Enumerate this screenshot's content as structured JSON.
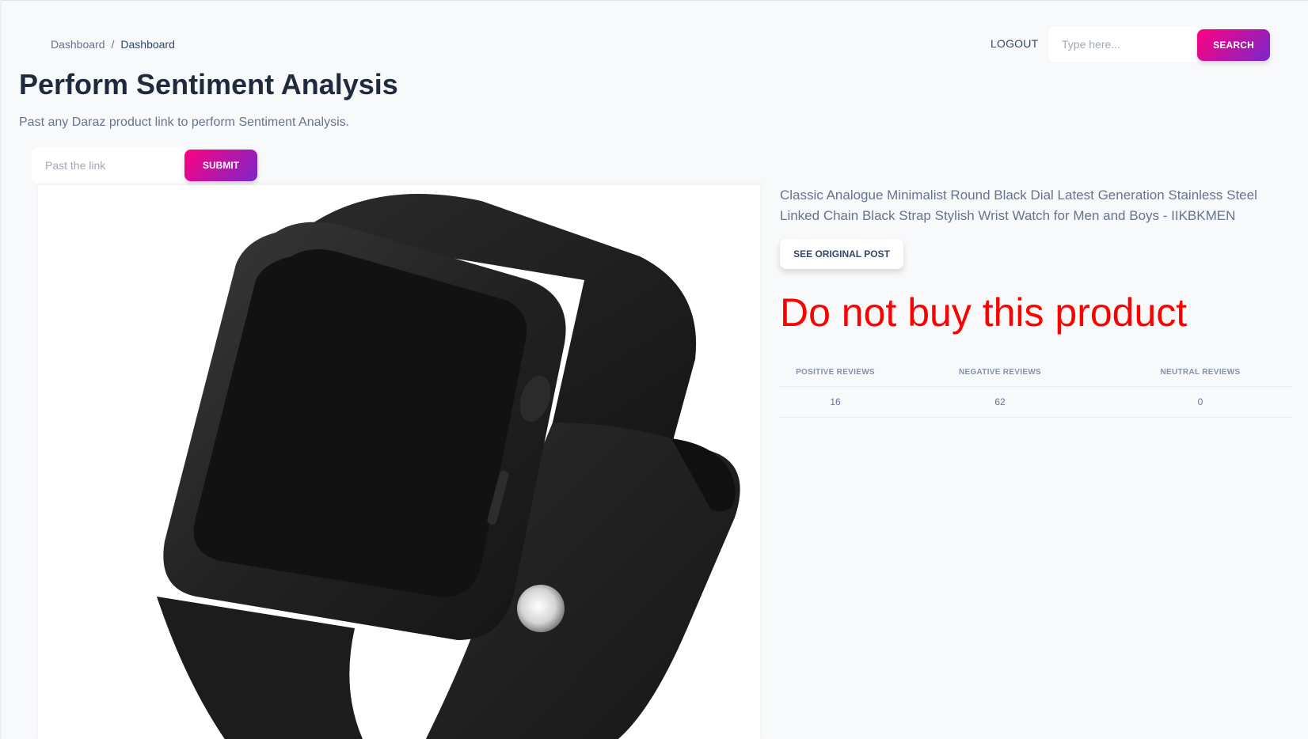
{
  "breadcrumb": {
    "parent": "Dashboard",
    "separator": "/",
    "current": "Dashboard"
  },
  "navbar": {
    "logout_label": "LOGOUT",
    "search_placeholder": "Type here...",
    "search_button": "SEARCH"
  },
  "page": {
    "title": "Perform Sentiment Analysis",
    "subtitle": "Past any Daraz product link to perform Sentiment Analysis."
  },
  "form": {
    "link_placeholder": "Past the link",
    "submit_label": "SUBMIT"
  },
  "product": {
    "image_icon": "smartwatch-image",
    "title": "Classic Analogue Minimalist Round Black Dial Latest Generation Stainless Steel Linked Chain Black Strap Stylish Wrist Watch for Men and Boys - IIKBKMEN",
    "see_original_label": "SEE ORIGINAL POST",
    "verdict": "Do not buy this product",
    "verdict_color": "#ff0000"
  },
  "reviews": {
    "headers": [
      "POSITIVE REVIEWS",
      "NEGATIVE REVIEWS",
      "NEUTRAL REVIEWS"
    ],
    "values": [
      "16",
      "62",
      "0"
    ]
  },
  "colors": {
    "accent_gradient_start": "#7928ca",
    "accent_gradient_end": "#ff0080",
    "background": "#f8f9fa"
  }
}
